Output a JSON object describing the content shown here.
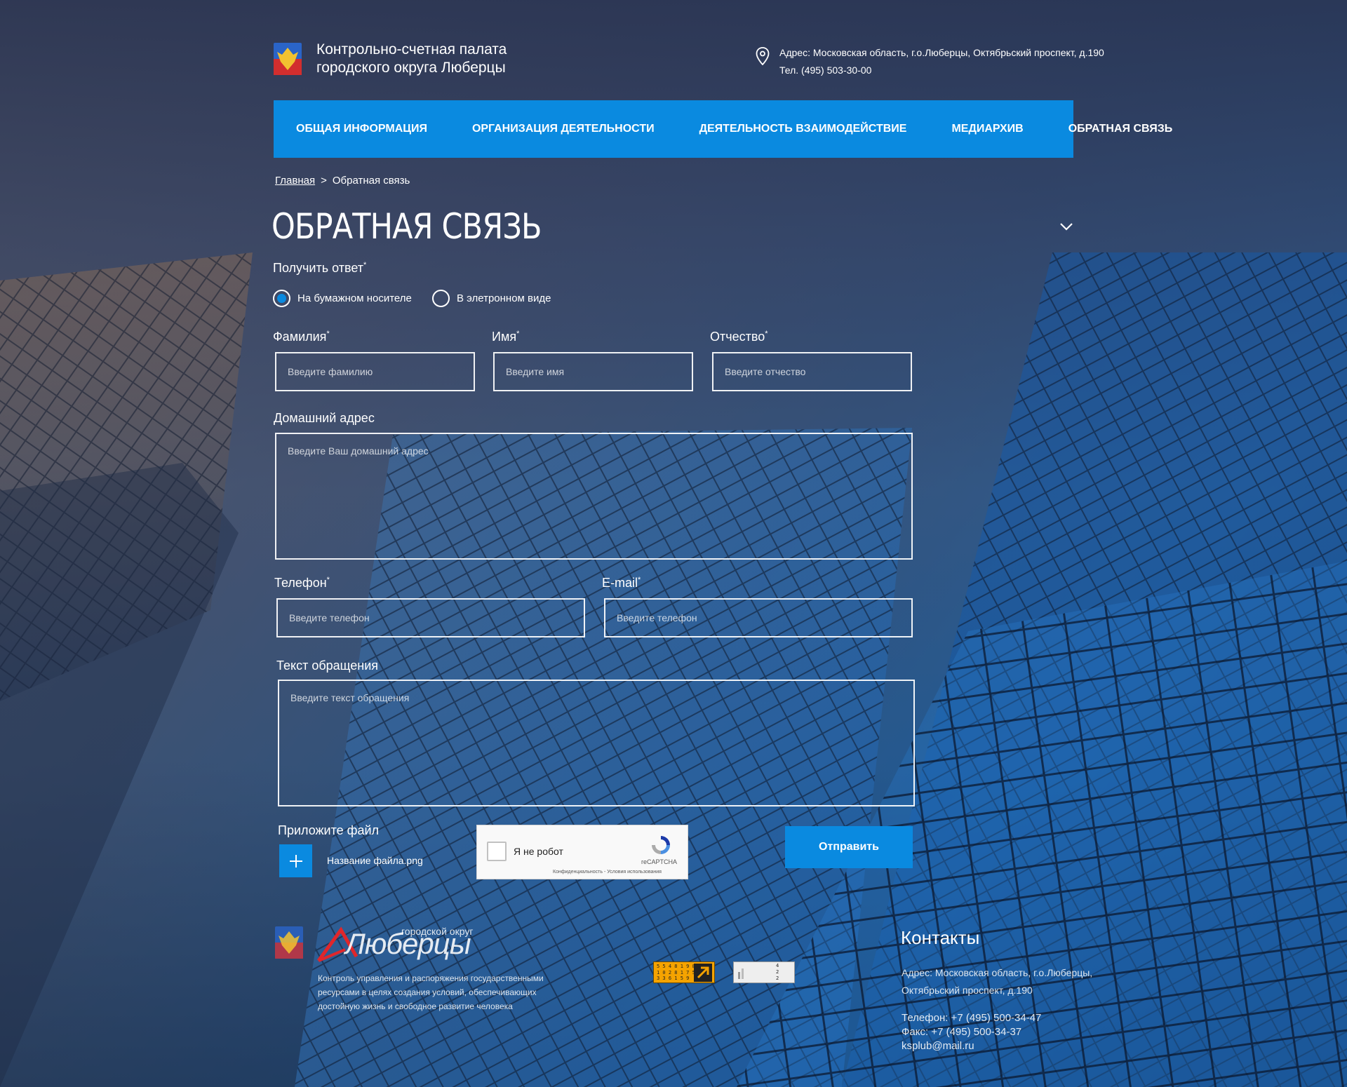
{
  "header": {
    "title_line1": "Контрольно-счетная палата",
    "title_line2": "городского округа Люберцы",
    "address": "Адрес: Московская область, г.о.Люберцы, Октябрьский проспект, д.190",
    "phone": "Тел. (495) 503-30-00"
  },
  "nav": {
    "items": [
      {
        "label": "Общая информация"
      },
      {
        "label": "Организация деятельности"
      },
      {
        "label": "Деятельность  Взаимодействие"
      },
      {
        "label": "Медиархив"
      },
      {
        "label": "Обратная связь"
      }
    ]
  },
  "breadcrumb": {
    "home": "Главная",
    "separator": ">",
    "current": "Обратная связь"
  },
  "page": {
    "title": "ОБРАТНАЯ СВЯЗЬ"
  },
  "form": {
    "response_label": "Получить ответ",
    "required_mark": "*",
    "response_options": [
      {
        "label": "На бумажном носителе",
        "selected": true
      },
      {
        "label": "В элетронном виде",
        "selected": false
      }
    ],
    "surname": {
      "label": "Фамилия",
      "placeholder": "Введите фамилию",
      "value": ""
    },
    "name": {
      "label": "Имя",
      "placeholder": "Введите имя",
      "value": ""
    },
    "patronymic": {
      "label": "Отчество",
      "placeholder": "Введите отчество",
      "value": ""
    },
    "address": {
      "label": "Домашний адрес",
      "placeholder": "Введите Ваш домашний адрес",
      "value": ""
    },
    "phone": {
      "label": "Телефон",
      "placeholder": "Введите телефон",
      "value": ""
    },
    "email": {
      "label": "E-mail",
      "placeholder": "Введите телефон",
      "value": ""
    },
    "message": {
      "label": "Текст обращения",
      "placeholder": "Введите текст обращения",
      "value": ""
    },
    "attach_label": "Приложите файл",
    "file_name": "Название файла.png",
    "submit_label": "Отправить"
  },
  "captcha": {
    "label": "Я не робот",
    "brand": "reCAPTCHA",
    "terms": "Конфиденциальность - Условия использования"
  },
  "footer": {
    "logo_small": "городской округ",
    "logo_big": "Люберцы",
    "tagline": "Контроль управления и распоряжения государственными ресурсами в целях создания условий, обеспечивающих достойную жизнь и свободное развитие человека",
    "counter_numbers": [
      "5 5 4 8 1 9 8",
      "1 0 2 8 1 7 5",
      "3 3 6 1 5 9"
    ],
    "counter2_numbers": [
      "4",
      "2",
      "2"
    ],
    "contacts_title": "Контакты",
    "address_line1": "Адрес: Московская область, г.о.Люберцы,",
    "address_line2": "Октябрьский проспект, д.190",
    "phone": "Телефон: +7 (495) 500-34-47",
    "fax": "Факс: +7 (495) 500-34-37",
    "email": "ksplub@mail.ru"
  },
  "colors": {
    "accent": "#0a8ae0"
  }
}
